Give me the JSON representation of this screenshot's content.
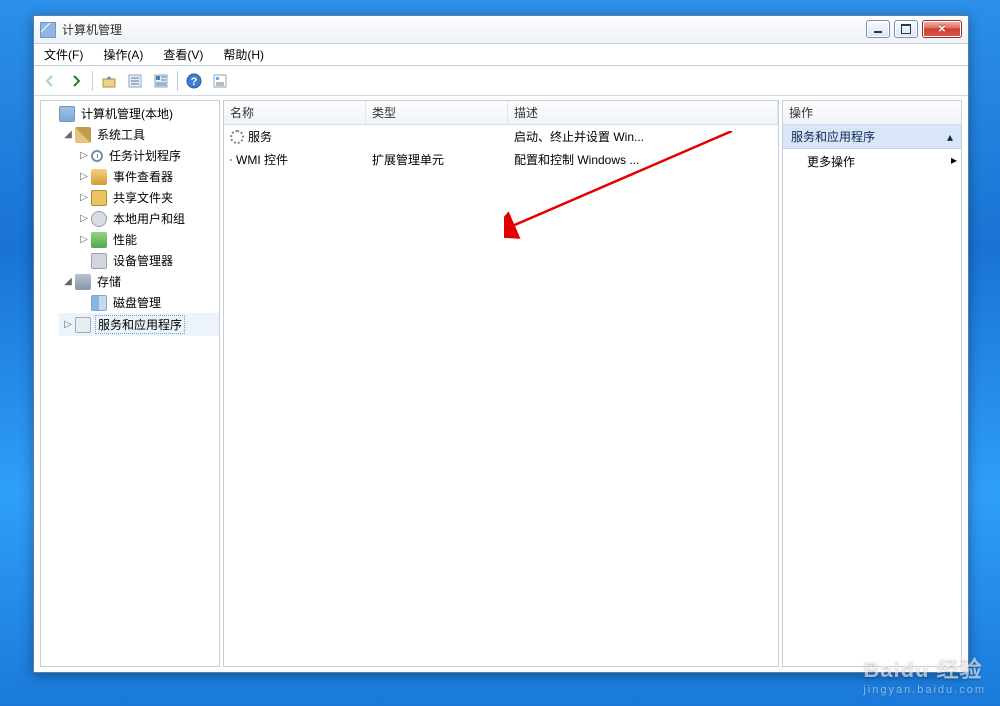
{
  "window": {
    "title": "计算机管理"
  },
  "menu": {
    "file": "文件(F)",
    "action": "操作(A)",
    "view": "查看(V)",
    "help": "帮助(H)"
  },
  "tree": {
    "root": "计算机管理(本地)",
    "sys_tools": "系统工具",
    "task_sched": "任务计划程序",
    "event_viewer": "事件查看器",
    "shared": "共享文件夹",
    "local_users": "本地用户和组",
    "perf": "性能",
    "devmgr": "设备管理器",
    "storage": "存储",
    "diskmgmt": "磁盘管理",
    "svcapps": "服务和应用程序"
  },
  "list": {
    "headers": {
      "name": "名称",
      "type": "类型",
      "desc": "描述"
    },
    "rows": [
      {
        "name": "服务",
        "type": "",
        "desc": "启动、终止并设置 Win..."
      },
      {
        "name": "WMI 控件",
        "type": "扩展管理单元",
        "desc": "配置和控制 Windows ..."
      }
    ]
  },
  "actions": {
    "title": "操作",
    "group": "服务和应用程序",
    "more": "更多操作"
  },
  "watermark": {
    "brand": "Baidu 经验",
    "url": "jingyan.baidu.com"
  }
}
